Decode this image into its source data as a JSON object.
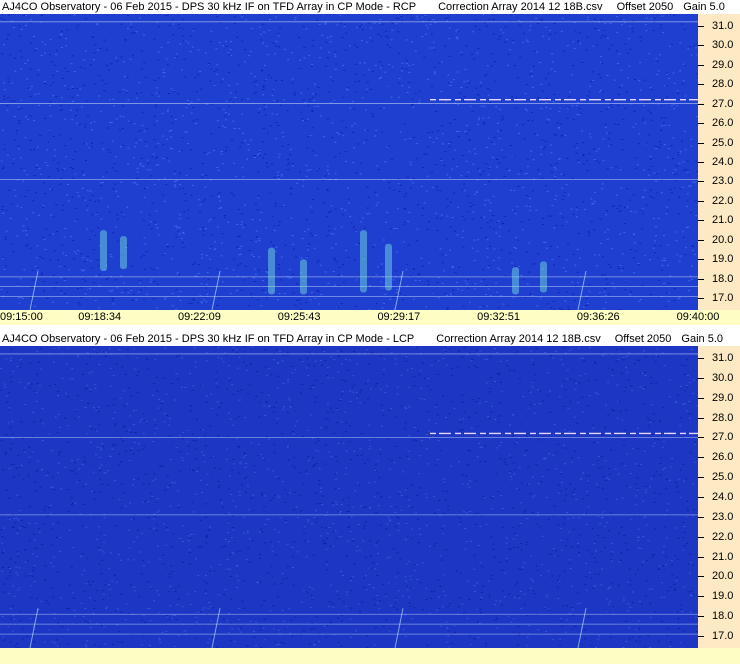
{
  "chart_data": [
    {
      "type": "heatmap",
      "title": "AJ4CO Observatory - 06 Feb 2015 - DPS 30 kHz IF on TFD Array in CP Mode - RCP",
      "correction": "Correction Array 2014 12 18B.csv",
      "offset": "Offset 2050",
      "gain": "Gain 5.0",
      "x_tick_labels": [
        "09:15:00",
        "09:18:34",
        "09:22:09",
        "09:25:43",
        "09:29:17",
        "09:32:51",
        "09:36:26",
        "09:40:00"
      ],
      "y_tick_labels": [
        "31.0",
        "30.0",
        "29.0",
        "28.0",
        "27.0",
        "26.0",
        "25.0",
        "24.0",
        "23.0",
        "22.0",
        "21.0",
        "20.0",
        "19.0",
        "18.0",
        "17.0"
      ],
      "ylim": [
        16.4,
        31.6
      ],
      "colors": {
        "background": "#1f3fd0",
        "noise_dark": "#0a1aa8",
        "noise_light": "#4a7af0",
        "burst": "#7fe8e0",
        "line": "#e8f4ff"
      }
    },
    {
      "type": "heatmap",
      "title": "AJ4CO Observatory - 06 Feb 2015 - DPS 30 kHz IF on TFD Array in CP Mode - LCP",
      "correction": "Correction Array 2014 12 18B.csv",
      "offset": "Offset 2050",
      "gain": "Gain 5.0",
      "y_tick_labels": [
        "31.0",
        "30.0",
        "29.0",
        "28.0",
        "27.0",
        "26.0",
        "25.0",
        "24.0",
        "23.0",
        "22.0",
        "21.0",
        "20.0",
        "19.0",
        "18.0",
        "17.0"
      ],
      "ylim": [
        16.4,
        31.6
      ],
      "colors": {
        "background": "#1d36c4",
        "noise_dark": "#0c1a9a",
        "noise_light": "#3f66e0",
        "burst": "#5fc0e8",
        "line": "#d8ecff"
      }
    }
  ]
}
